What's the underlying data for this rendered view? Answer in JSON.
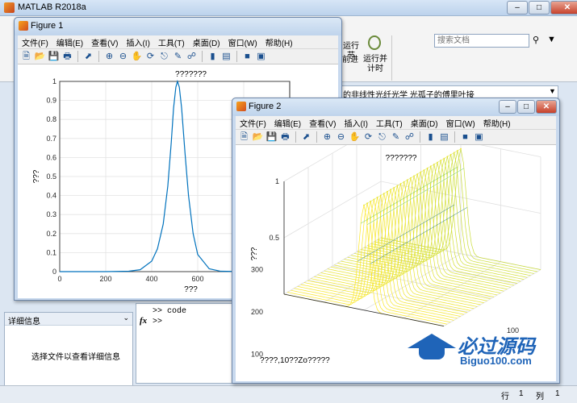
{
  "main_window": {
    "title": "MATLAB R2018a",
    "search_placeholder": "搜索文档",
    "toolstrip": {
      "run_section_label": "运行节",
      "advance_label": "前进",
      "run_time_label_1": "运行并",
      "run_time_label_2": "计时"
    },
    "path_text": "的非线性光纤光学 光孤子的傅里叶接",
    "detail_panel": {
      "header": "详细信息",
      "message": "选择文件以查看详细信息"
    },
    "command_window": {
      "line1": ">> code",
      "prompt_symbol": "fx",
      "prompt": ">>"
    },
    "status": {
      "row_label": "行",
      "row_value": "1",
      "col_label": "列",
      "col_value": "1"
    },
    "watermark": {
      "brand": "必过源码",
      "url": "Biguo100.com"
    }
  },
  "figure1": {
    "title": "Figure 1",
    "menu": [
      "文件(F)",
      "编辑(E)",
      "查看(V)",
      "插入(I)",
      "工具(T)",
      "桌面(D)",
      "窗口(W)",
      "帮助(H)"
    ],
    "tools": [
      "new-icon",
      "open-icon",
      "save-icon",
      "print-icon",
      "pointer-icon",
      "zoom-in-icon",
      "zoom-out-icon",
      "pan-icon",
      "rotate-icon",
      "datatip-icon",
      "brush-icon",
      "link-icon",
      "colorbar-icon",
      "legend-icon",
      "hide-icon",
      "show-icon"
    ],
    "plot_title": "???????",
    "ylabel": "???",
    "xlabel": "???"
  },
  "figure2": {
    "title": "Figure 2",
    "menu": [
      "文件(F)",
      "编辑(E)",
      "查看(V)",
      "插入(I)",
      "工具(T)",
      "桌面(D)",
      "窗口(W)",
      "帮助(H)"
    ],
    "tools": [
      "new-icon",
      "open-icon",
      "save-icon",
      "print-icon",
      "pointer-icon",
      "zoom-in-icon",
      "zoom-out-icon",
      "pan-icon",
      "rotate-icon",
      "datatip-icon",
      "brush-icon",
      "link-icon",
      "colorbar-icon",
      "legend-icon",
      "hide-icon",
      "show-icon"
    ],
    "plot_title": "???????",
    "zlabel": "???",
    "bottom_label": "????,10??Zo?????",
    "y_ticks": [
      "300",
      "200",
      "100"
    ],
    "z_ticks": [
      "1",
      "0.5"
    ],
    "x_ticks": [
      "100",
      "10"
    ]
  },
  "chart_data": [
    {
      "type": "line",
      "title": "???????",
      "xlabel": "???",
      "ylabel": "???",
      "xlim": [
        0,
        1000
      ],
      "ylim": [
        0,
        1
      ],
      "x_ticks": [
        0,
        200,
        400,
        600,
        800
      ],
      "y_ticks": [
        0,
        0.1,
        0.2,
        0.3,
        0.4,
        0.5,
        0.6,
        0.7,
        0.8,
        0.9,
        1
      ],
      "grid": true,
      "series": [
        {
          "color": "#0072bd",
          "x": [
            0,
            200,
            300,
            350,
            400,
            425,
            450,
            470,
            485,
            495,
            505,
            512,
            520,
            530,
            545,
            560,
            580,
            600,
            650,
            700,
            800,
            900,
            1000
          ],
          "y": [
            0,
            0,
            0.002,
            0.01,
            0.055,
            0.12,
            0.25,
            0.45,
            0.68,
            0.86,
            0.97,
            1.0,
            0.97,
            0.86,
            0.62,
            0.4,
            0.2,
            0.09,
            0.015,
            0.002,
            0,
            0,
            0
          ]
        }
      ]
    },
    {
      "type": "surface-mesh",
      "title": "???????",
      "zlabel": "???",
      "zlim": [
        0,
        1
      ],
      "traces": 30,
      "colormap": [
        "#440154",
        "#3b528b",
        "#21918c",
        "#5ec962",
        "#fde725"
      ]
    }
  ]
}
